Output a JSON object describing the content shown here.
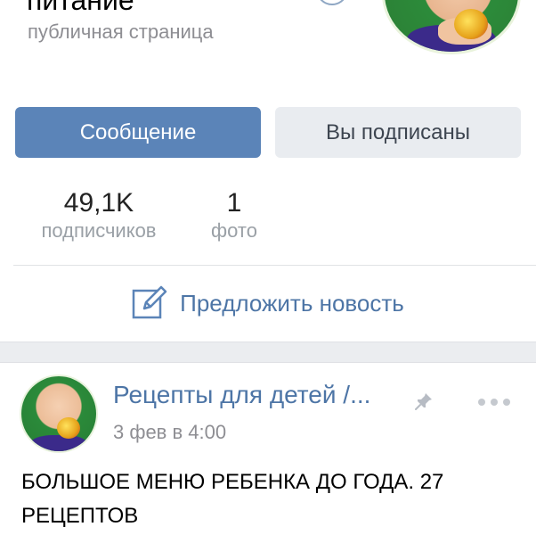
{
  "header": {
    "page_name": "питание",
    "page_type": "публичная страница"
  },
  "actions": {
    "message_label": "Сообщение",
    "subscribed_label": "Вы подписаны"
  },
  "stats": {
    "followers_value": "49,1K",
    "followers_label": "подписчиков",
    "photos_value": "1",
    "photos_label": "фото"
  },
  "suggest": {
    "label": "Предложить новость",
    "icon": "edit-icon"
  },
  "post": {
    "author": "Рецепты для детей /...",
    "time": "3 фев в 4:00",
    "text": "БОЛЬШОЕ МЕНЮ РЕБЕНКА ДО ГОДА. 27 РЕЦЕПТОВ",
    "icons": [
      "pin-icon",
      "more-icon"
    ]
  },
  "colors": {
    "accent": "#5b84b8",
    "link": "#4d75a6",
    "secondary_button": "#e9ecf0",
    "muted_text": "#8e8e93"
  }
}
